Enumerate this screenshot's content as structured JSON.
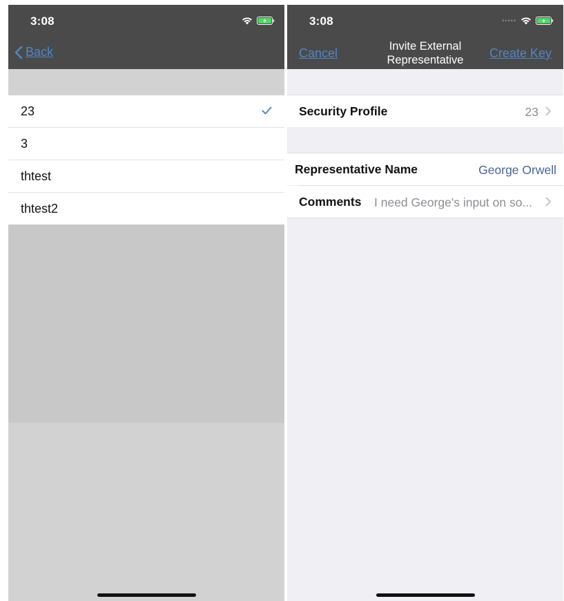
{
  "left_screen": {
    "status": {
      "time": "3:08"
    },
    "nav": {
      "back_label": "Back"
    },
    "items": [
      {
        "label": "23",
        "selected": true
      },
      {
        "label": "3",
        "selected": false
      },
      {
        "label": "thtest",
        "selected": false
      },
      {
        "label": "thtest2",
        "selected": false
      }
    ]
  },
  "right_screen": {
    "status": {
      "time": "3:08"
    },
    "nav": {
      "cancel_label": "Cancel",
      "title_line1": "Invite External",
      "title_line2": "Representative",
      "create_label": "Create Key"
    },
    "security_profile": {
      "label": "Security Profile",
      "value": "23"
    },
    "representative_name": {
      "label": "Representative Name",
      "value": "George Orwell"
    },
    "comments": {
      "label": "Comments",
      "value": "I need George's input on so..."
    }
  },
  "colors": {
    "nav_background": "#4a4a4a",
    "accent_link": "#4f86c6",
    "name_value": "#4b6396",
    "secondary_text": "#8e8e93",
    "checkmark": "#4f86c6"
  },
  "icons": [
    "wifi-icon",
    "battery-charging-icon",
    "chevron-left-icon",
    "checkmark-icon",
    "chevron-right-icon"
  ]
}
